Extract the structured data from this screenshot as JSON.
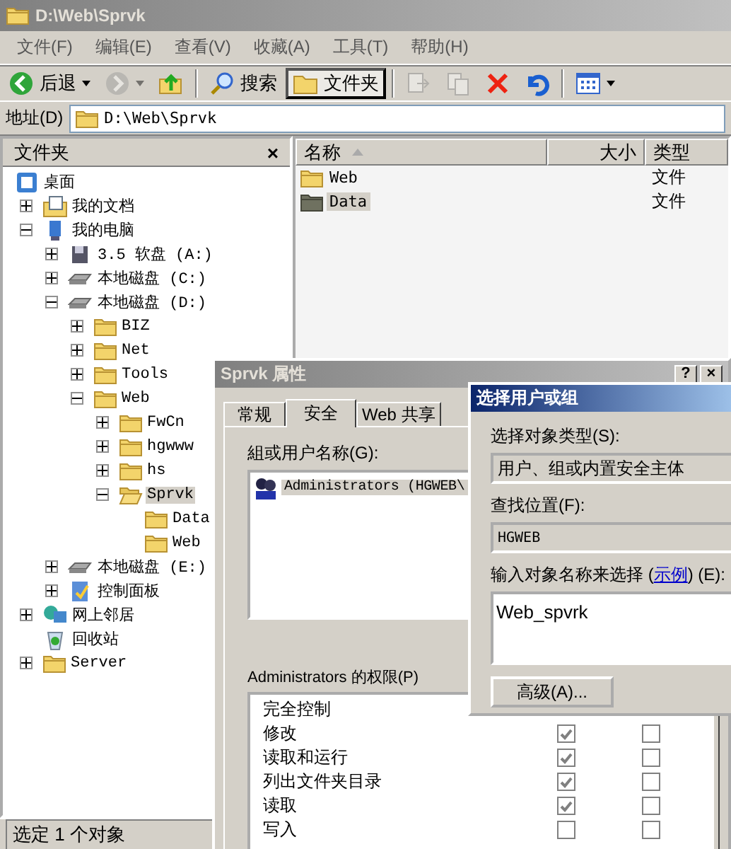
{
  "window": {
    "title": "D:\\Web\\Sprvk"
  },
  "menu": [
    "文件(F)",
    "编辑(E)",
    "查看(V)",
    "收藏(A)",
    "工具(T)",
    "帮助(H)"
  ],
  "toolbar": {
    "groups": [
      [
        {
          "kind": "back",
          "label": "后退",
          "dropdown": true,
          "disabled": false,
          "pressed": false
        },
        {
          "kind": "forward",
          "dropdown": true,
          "disabled": true,
          "pressed": false
        },
        {
          "kind": "up",
          "dropdown": false,
          "disabled": false,
          "pressed": false
        }
      ],
      [
        {
          "kind": "search",
          "label": "搜索",
          "dropdown": false,
          "disabled": false,
          "pressed": false
        },
        {
          "kind": "folders",
          "label": "文件夹",
          "dropdown": false,
          "disabled": false,
          "pressed": true
        }
      ],
      [
        {
          "kind": "move",
          "dropdown": false,
          "disabled": true,
          "pressed": false
        },
        {
          "kind": "copy",
          "dropdown": false,
          "disabled": true,
          "pressed": false
        },
        {
          "kind": "delete",
          "dropdown": false,
          "disabled": false,
          "pressed": false
        },
        {
          "kind": "undo",
          "dropdown": false,
          "disabled": false,
          "pressed": false
        }
      ],
      [
        {
          "kind": "views",
          "dropdown": true,
          "disabled": false,
          "pressed": false
        }
      ]
    ]
  },
  "address": {
    "label": "地址(D)",
    "value": "D:\\Web\\Sprvk"
  },
  "folders_pane": {
    "title": "文件夹",
    "close": "×",
    "tree": [
      {
        "label": "桌面",
        "kind": "desktop",
        "expandable": false,
        "selected": false,
        "children": [
          {
            "label": "我的文档",
            "kind": "documents",
            "expandable": true,
            "expanded": false,
            "selected": false
          },
          {
            "label": "我的电脑",
            "kind": "computer",
            "expandable": true,
            "expanded": true,
            "selected": false,
            "children": [
              {
                "label": "3.5 软盘 (A:)",
                "kind": "floppy",
                "expandable": true,
                "expanded": false,
                "selected": false
              },
              {
                "label": "本地磁盘 (C:)",
                "kind": "drive",
                "expandable": true,
                "expanded": false,
                "selected": false
              },
              {
                "label": "本地磁盘 (D:)",
                "kind": "drive",
                "expandable": true,
                "expanded": true,
                "selected": false,
                "children": [
                  {
                    "label": "BIZ",
                    "kind": "folder",
                    "expandable": true,
                    "expanded": false,
                    "selected": false
                  },
                  {
                    "label": "Net",
                    "kind": "folder",
                    "expandable": true,
                    "expanded": false,
                    "selected": false
                  },
                  {
                    "label": "Tools",
                    "kind": "folder",
                    "expandable": true,
                    "expanded": false,
                    "selected": false
                  },
                  {
                    "label": "Web",
                    "kind": "folder",
                    "expandable": true,
                    "expanded": true,
                    "selected": false,
                    "children": [
                      {
                        "label": "FwCn",
                        "kind": "folder",
                        "expandable": true,
                        "expanded": false,
                        "selected": false
                      },
                      {
                        "label": "hgwww",
                        "kind": "folder",
                        "expandable": true,
                        "expanded": false,
                        "selected": false
                      },
                      {
                        "label": "hs",
                        "kind": "folder",
                        "expandable": true,
                        "expanded": false,
                        "selected": false
                      },
                      {
                        "label": "Sprvk",
                        "kind": "folder-open",
                        "expandable": true,
                        "expanded": true,
                        "selected": true,
                        "children": [
                          {
                            "label": "Data",
                            "kind": "folder",
                            "expandable": false,
                            "expanded": false,
                            "selected": false
                          },
                          {
                            "label": "Web",
                            "kind": "folder",
                            "expandable": false,
                            "expanded": false,
                            "selected": false
                          }
                        ]
                      }
                    ]
                  }
                ]
              },
              {
                "label": "本地磁盘 (E:)",
                "kind": "drive",
                "expandable": true,
                "expanded": false,
                "selected": false
              },
              {
                "label": "控制面板",
                "kind": "control",
                "expandable": true,
                "expanded": false,
                "selected": false
              }
            ]
          },
          {
            "label": "网上邻居",
            "kind": "network",
            "expandable": true,
            "expanded": false,
            "selected": false
          },
          {
            "label": "回收站",
            "kind": "recycle",
            "expandable": false,
            "expanded": false,
            "selected": false
          },
          {
            "label": "Server",
            "kind": "folder",
            "expandable": true,
            "expanded": false,
            "selected": false
          }
        ]
      }
    ]
  },
  "file_list": {
    "columns": [
      {
        "label": "名称",
        "sorted": true
      },
      {
        "label": "大小",
        "sorted": false
      },
      {
        "label": "类型",
        "sorted": false
      }
    ],
    "rows": [
      {
        "name": "Web",
        "type": "文件",
        "selected": false
      },
      {
        "name": "Data",
        "type": "文件",
        "selected": true
      }
    ]
  },
  "status_bar": "选定 1 个对象",
  "properties_dialog": {
    "title": "Sprvk 属性",
    "help": "?",
    "close": "×",
    "tabs": [
      {
        "label": "常规",
        "selected": false
      },
      {
        "label": "安全",
        "selected": true
      },
      {
        "label": "Web 共享",
        "selected": false
      }
    ],
    "groups_label": "組或用户名称(G):",
    "principals": [
      {
        "name": "Administrators (HGWEB\\",
        "selected": true
      }
    ],
    "permissions_label": "Administrators 的权限(P)",
    "permissions": [
      {
        "name": "完全控制"
      },
      {
        "name": "修改",
        "allow": true,
        "deny": false
      },
      {
        "name": "读取和运行",
        "allow": true,
        "deny": false
      },
      {
        "name": "列出文件夹目录",
        "allow": true,
        "deny": false
      },
      {
        "name": "读取",
        "allow": true,
        "deny": false
      },
      {
        "name": "写入",
        "allow": false,
        "deny": false
      }
    ]
  },
  "select_dialog": {
    "title": "选择用户或组",
    "object_type_label": "选择对象类型(S):",
    "object_type": "用户、组或内置安全主体",
    "location_label": "查找位置(F):",
    "location": "HGWEB",
    "names_label": {
      "before": "输入对象名称来选择 (",
      "link": "示例",
      "after": ") (E):"
    },
    "names_value": "Web_spvrk",
    "advanced_button": "高级(A)..."
  }
}
